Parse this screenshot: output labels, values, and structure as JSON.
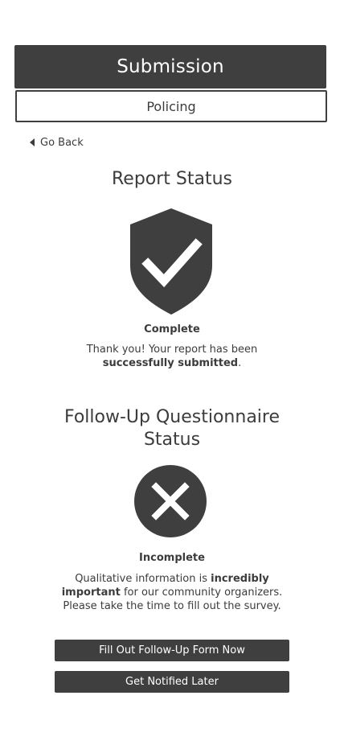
{
  "header": {
    "title": "Submission",
    "category": "Policing"
  },
  "nav": {
    "back_label": "Go Back"
  },
  "report": {
    "title": "Report Status",
    "icon": "shield-check-icon",
    "status": "Complete",
    "message_prefix": "Thank you! Your report has been ",
    "message_bold": "successfully submitted",
    "message_suffix": "."
  },
  "followup": {
    "title_line1": "Follow-Up Questionnaire",
    "title_line2": "Status",
    "icon": "x-circle-icon",
    "status": "Incomplete",
    "message_prefix": "Qualitative information is ",
    "message_bold": "incredibly important",
    "message_suffix": " for our community organizers. Please take the time to fill out the survey."
  },
  "actions": {
    "fill_out_label": "Fill Out Follow-Up Form Now",
    "notify_label": "Get Notified Later"
  },
  "colors": {
    "dark": "#3f3f3f",
    "text": "#3c3c3c",
    "background": "#ffffff"
  }
}
